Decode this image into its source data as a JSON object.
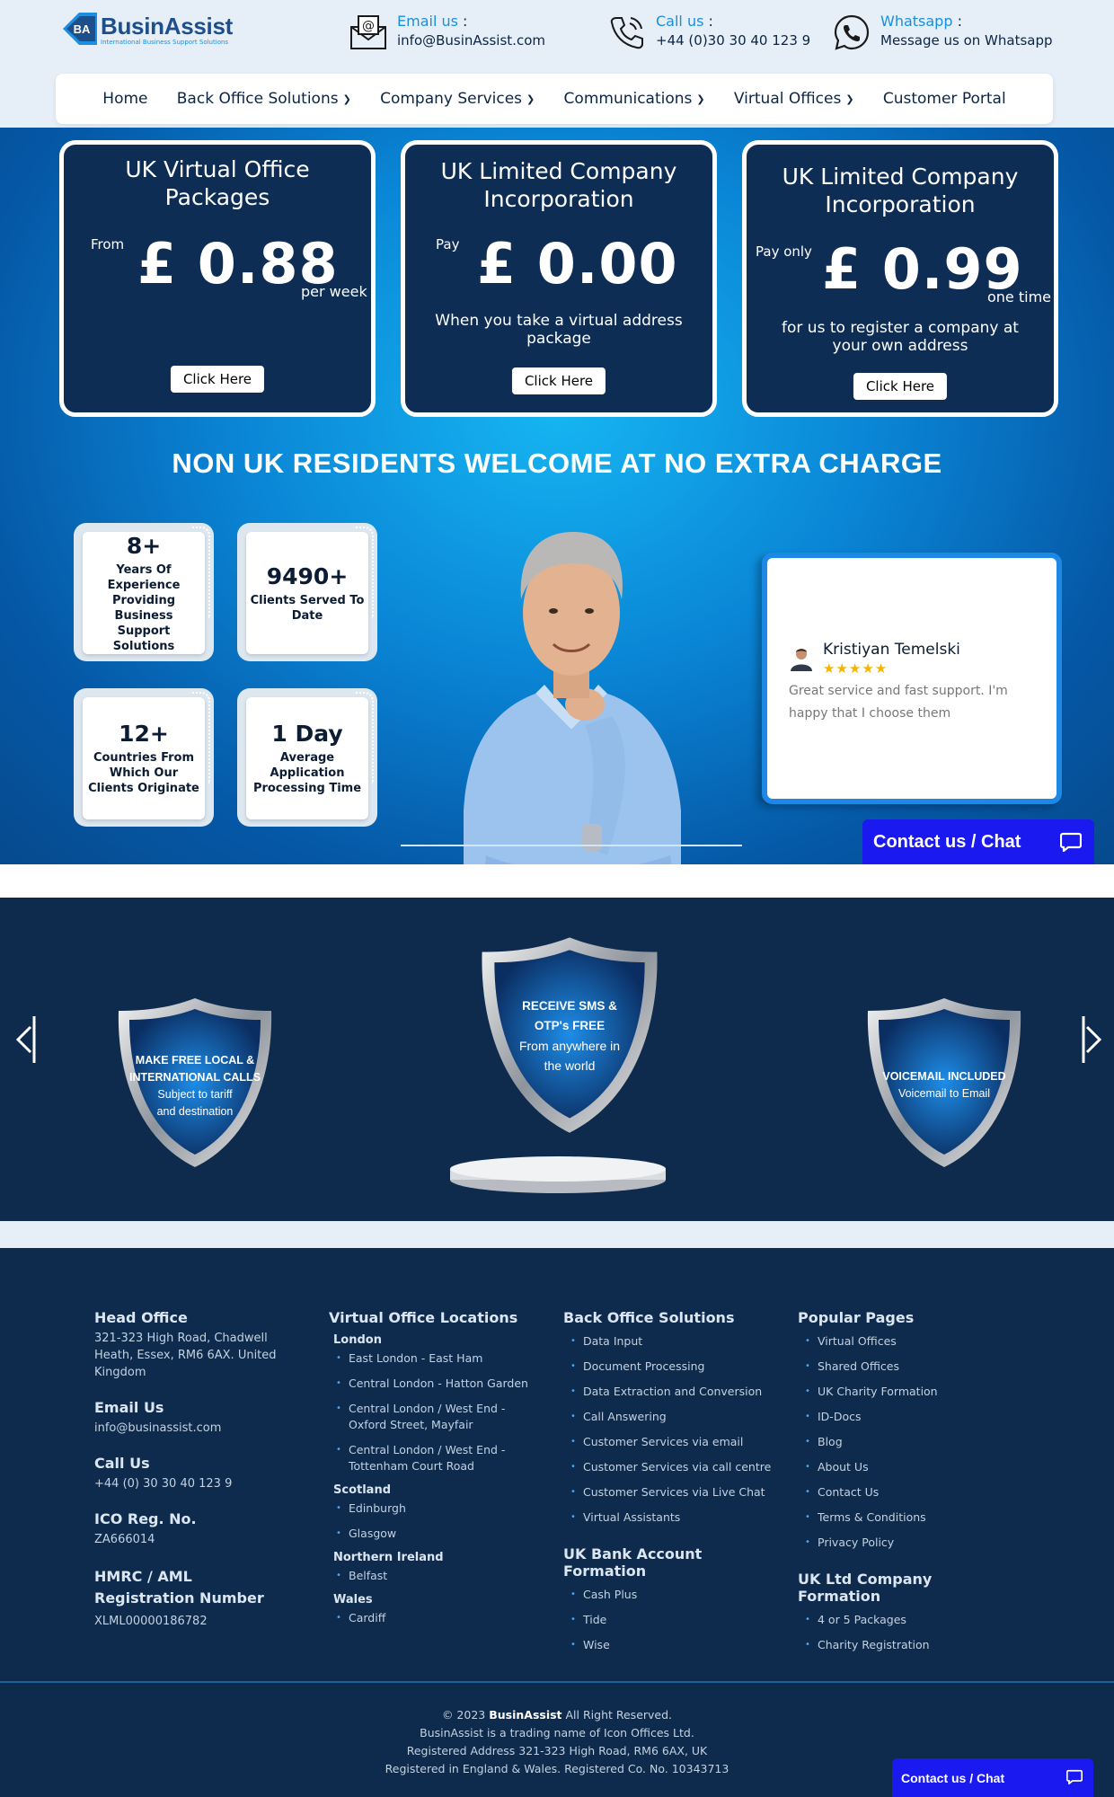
{
  "header": {
    "logo": {
      "name": "BusinAssist",
      "tagline": "International Business Support Solutions",
      "mark": "BA"
    },
    "email": {
      "label": "Email us",
      "value": "info@BusinAssist.com",
      "icon": "email-icon"
    },
    "call": {
      "label": "Call us",
      "value": "+44 (0)30 30 40 123 9",
      "icon": "phone-icon"
    },
    "whatsapp": {
      "label": "Whatsapp",
      "value": "Message us on Whatsapp",
      "icon": "whatsapp-icon"
    }
  },
  "nav": {
    "items": [
      {
        "label": "Home"
      },
      {
        "label": "Back Office Solutions"
      },
      {
        "label": "Company Services"
      },
      {
        "label": "Communications"
      },
      {
        "label": "Virtual Offices"
      },
      {
        "label": "Customer Portal"
      }
    ]
  },
  "packages": [
    {
      "title": "UK Virtual Office Packages",
      "prefix": "From",
      "price": "£ 0.88",
      "unit": "per week",
      "desc": "",
      "button": "Click Here"
    },
    {
      "title": "UK Limited Company Incorporation",
      "prefix": "Pay",
      "price": "£ 0.00",
      "unit": "",
      "desc": "When you take a virtual address package",
      "button": "Click Here"
    },
    {
      "title": "UK Limited Company Incorporation",
      "prefix": "Pay only",
      "price": "£ 0.99",
      "unit": "one time",
      "desc": "for us to register a company at your own address",
      "button": "Click Here"
    }
  ],
  "welcome": "NON UK RESIDENTS WELCOME AT NO EXTRA CHARGE",
  "stats": [
    {
      "num": "8+",
      "text": "Years Of Experience Providing Business Support Solutions"
    },
    {
      "num": "9490+",
      "text": "Clients Served To Date"
    },
    {
      "num": "12+",
      "text": "Countries From Which Our Clients Originate"
    },
    {
      "num": "1 Day",
      "text": "Average Application Processing Time"
    }
  ],
  "review": {
    "name": "Kristiyan Temelski",
    "stars": "★★★★★",
    "rating": 5,
    "text": "Great service and fast support. I'm happy that I choose them"
  },
  "chat": {
    "label": "Contact us  / Chat"
  },
  "shields": {
    "left": {
      "line1": "MAKE FREE LOCAL &",
      "line2": "INTERNATIONAL CALLS",
      "line3": "Subject to tariff",
      "line4": "and destination"
    },
    "center": {
      "line1": "RECEIVE SMS &",
      "line2": "OTP's FREE",
      "line3": "From anywhere in",
      "line4": "the world"
    },
    "right": {
      "line1": "VOICEMAIL INCLUDED",
      "line2": "Voicemail to Email"
    }
  },
  "footer": {
    "head_office": {
      "title": "Head Office",
      "address": "321-323 High Road, Chadwell Heath, Essex, RM6 6AX. United Kingdom"
    },
    "email": {
      "title": "Email Us",
      "value": "info@businassist.com"
    },
    "call": {
      "title": "Call Us",
      "value": "+44 (0) 30 30 40 123 9"
    },
    "ico": {
      "title": "ICO Reg. No.",
      "value": "ZA666014"
    },
    "hmrc": {
      "title": "HMRC / AML Registration Number",
      "value": "XLML00000186782"
    },
    "locations": {
      "title": "Virtual Office Locations",
      "london": {
        "title": "London",
        "items": [
          "East London - East Ham",
          "Central London - Hatton Garden",
          "Central London / West End - Oxford Street, Mayfair",
          "Central London / West End - Tottenham Court Road"
        ]
      },
      "scotland": {
        "title": "Scotland",
        "items": [
          "Edinburgh",
          "Glasgow"
        ]
      },
      "ni": {
        "title": "Northern Ireland",
        "items": [
          "Belfast"
        ]
      },
      "wales": {
        "title": "Wales",
        "items": [
          "Cardiff"
        ]
      }
    },
    "back_office": {
      "title": "Back Office Solutions",
      "items": [
        "Data Input",
        "Document Processing",
        "Data Extraction and Conversion",
        "Call Answering",
        "Customer Services via email",
        "Customer Services via call centre",
        "Customer Services via Live Chat",
        "Virtual Assistants"
      ]
    },
    "bank": {
      "title": "UK Bank Account Formation",
      "items": [
        "Cash Plus",
        "Tide",
        "Wise"
      ]
    },
    "popular": {
      "title": "Popular Pages",
      "items": [
        "Virtual Offices",
        "Shared Offices",
        "UK Charity Formation",
        "ID-Docs",
        "Blog",
        "About Us",
        "Contact Us",
        "Terms & Conditions",
        "Privacy Policy"
      ]
    },
    "ltd": {
      "title": "UK Ltd Company Formation",
      "items": [
        "4 or 5 Packages",
        "Charity Registration"
      ]
    },
    "copyright": {
      "pre": "© 2023 ",
      "brand": "BusinAssist",
      "post": " All Right Reserved."
    },
    "lines": [
      "BusinAssist is a trading name of Icon Offices Ltd.",
      "Registered Address 321-323 High Road, RM6 6AX, UK",
      "Registered in England & Wales. Registered Co. No. 10343713"
    ]
  },
  "colors": {
    "navy": "#0e2a4d",
    "accent": "#1790e0",
    "chat": "#1a1af0",
    "star": "#f5b400"
  }
}
